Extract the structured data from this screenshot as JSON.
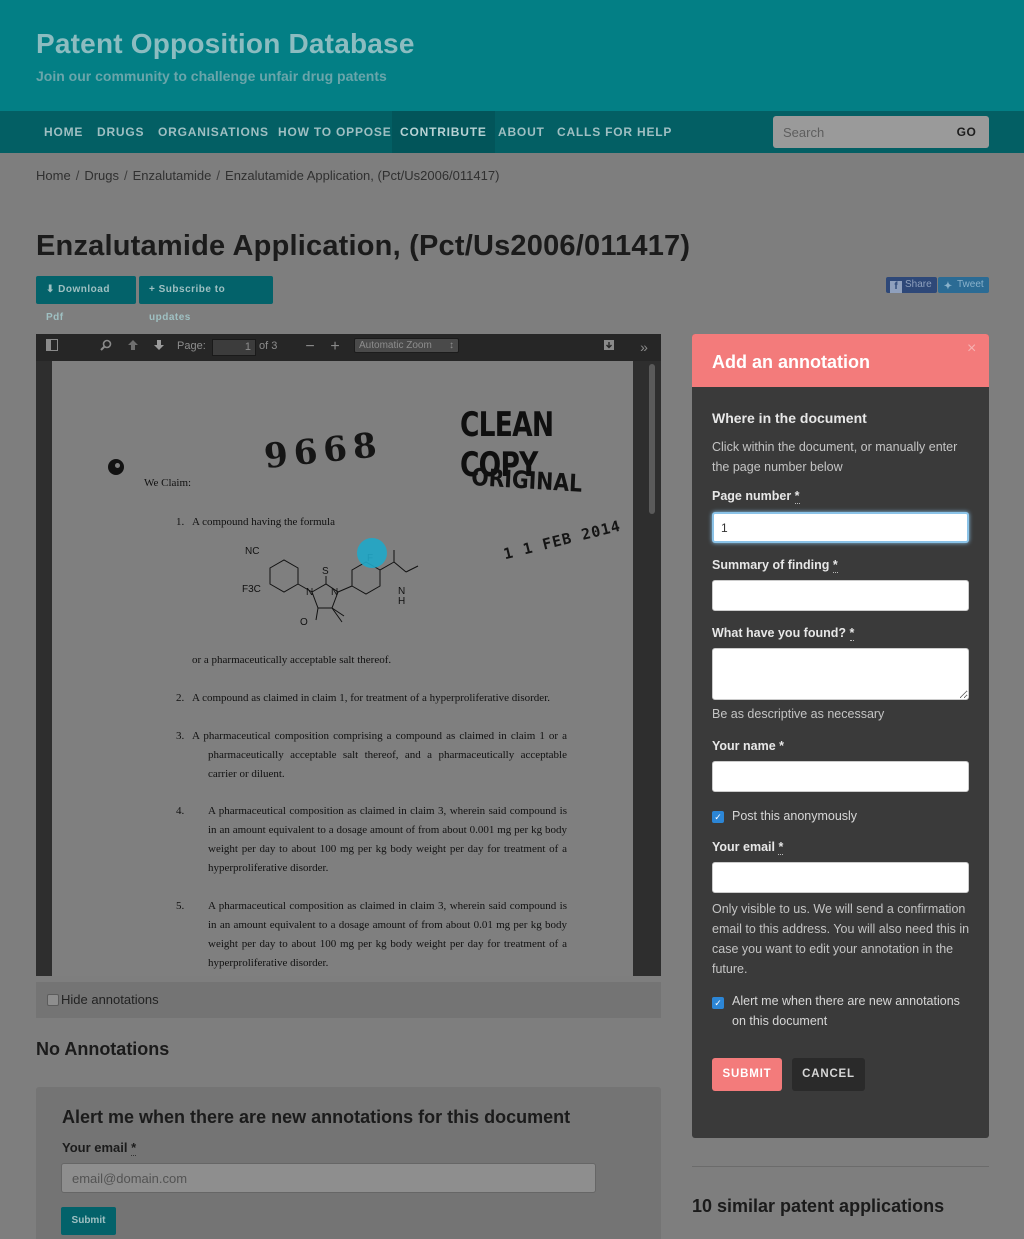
{
  "site": {
    "title": "Patent Opposition Database",
    "tagline": "Join our community to challenge unfair drug patents"
  },
  "nav": {
    "items": [
      "HOME",
      "DRUGS",
      "ORGANISATIONS",
      "HOW TO OPPOSE",
      "CONTRIBUTE",
      "ABOUT",
      "CALLS FOR HELP"
    ],
    "active": "CONTRIBUTE",
    "search_placeholder": "Search",
    "search_button": "GO"
  },
  "breadcrumb": [
    "Home",
    "Drugs",
    "Enzalutamide",
    "Enzalutamide Application, (Pct/Us2006/011417)"
  ],
  "page_title": "Enzalutamide Application, (Pct/Us2006/011417)",
  "actions": {
    "download": "Download Pdf",
    "subscribe": "Subscribe to updates",
    "share": "Share",
    "tweet": "Tweet"
  },
  "viewer": {
    "page_label": "Page:",
    "page_value": "1",
    "page_total": "of 3",
    "zoom": "Automatic Zoom",
    "document": {
      "stamp_number": "9668",
      "stamp_clean_copy": "CLEAN COPY",
      "stamp_original": "ORIGINAL",
      "stamp_date": "1 1 FEB 2014",
      "we_claim": "We Claim:",
      "claims": [
        {
          "num": "1.",
          "text": "A compound having the formula"
        },
        {
          "num": "",
          "text": "or a pharmaceutically acceptable salt thereof."
        },
        {
          "num": "2.",
          "text": "A compound as claimed in claim 1, for treatment of a hyperproliferative disorder."
        },
        {
          "num": "3.",
          "text": "A pharmaceutical composition comprising a compound as claimed in claim 1 or a pharmaceutically acceptable salt thereof, and a pharmaceutically acceptable carrier or diluent."
        },
        {
          "num": "4.",
          "text": "A pharmaceutical composition as claimed in claim 3, wherein said compound is in an amount equivalent to a dosage amount of from about 0.001 mg per kg body weight per day to about 100 mg per kg body weight per day for treatment of a hyperproliferative disorder."
        },
        {
          "num": "5.",
          "text": "A pharmaceutical composition as claimed in claim 3, wherein said compound is in an amount equivalent to a dosage amount of from about 0.01 mg per kg body weight per day to about 100 mg per kg body weight per day for treatment of a hyperproliferative disorder."
        }
      ],
      "formula_labels": [
        "NC",
        "F3C",
        "S",
        "F",
        "N",
        "N",
        "O",
        "N",
        "H"
      ]
    }
  },
  "hide_annotations": "Hide annotations",
  "no_annotations": "No Annotations",
  "alert": {
    "title": "Alert me when there are new annotations for this document",
    "email_label": "Your email",
    "email_placeholder": "email@domain.com",
    "submit": "Submit"
  },
  "annotation_form": {
    "title": "Add an annotation",
    "close": "×",
    "where_heading": "Where in the document",
    "where_help": "Click within the document, or manually enter the page number below",
    "page_number_label": "Page number",
    "page_number_value": "1",
    "summary_label": "Summary of finding",
    "found_label": "What have you found?",
    "found_help": "Be as descriptive as necessary",
    "name_label": "Your name",
    "anonymous_label": "Post this anonymously",
    "anonymous_checked": true,
    "email_label": "Your email",
    "email_help": "Only visible to us. We will send a confirmation email to this address. You will also need this in case you want to edit your annotation in the future.",
    "alert_label": "Alert me when there are new annotations on this document",
    "alert_checked": true,
    "submit": "SUBMIT",
    "cancel": "CANCEL"
  },
  "similar": {
    "title": "10 similar patent applications"
  },
  "colors": {
    "header": "#037f85",
    "nav": "#035f64",
    "accent": "#f37b7b",
    "panel": "#3a3a3a",
    "overlay_gray": "#7e7e7e"
  }
}
